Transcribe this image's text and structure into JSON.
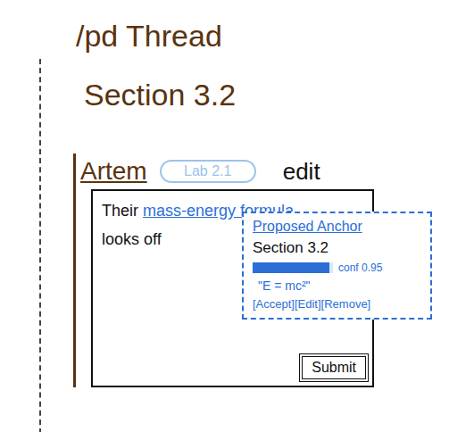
{
  "page": {
    "title": "/pd Thread",
    "subtitle": "Section 3.2"
  },
  "post": {
    "author": "Artem",
    "badge": "Lab 2.1",
    "action": "edit",
    "editor": {
      "text_before": "Their ",
      "highlight": "mass-energy formula",
      "text_after": "looks off"
    },
    "submit": "Submit"
  },
  "popover": {
    "title": "Proposed Anchor",
    "section": "Section 3.2",
    "confidence": {
      "level": 0.95,
      "reading": "conf 0.95"
    },
    "quote": "\"E = mc²\"",
    "actions": [
      "[Accept]",
      "[Edit]",
      "[Remove]"
    ]
  }
}
